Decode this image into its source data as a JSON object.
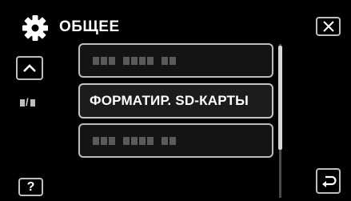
{
  "header": {
    "title": "ОБЩЕЕ",
    "settings_icon": "gear-icon"
  },
  "controls": {
    "close_icon": "close-icon",
    "up_icon": "chevron-up-icon",
    "help_label": "?",
    "back_icon": "return-icon"
  },
  "menu": {
    "items": [
      {
        "label": "",
        "disabled": true
      },
      {
        "label": "ФОРМАТИР. SD-КАРТЫ",
        "disabled": false
      },
      {
        "label": "",
        "disabled": true
      }
    ]
  },
  "page_indicator": {
    "separator": "/"
  },
  "colors": {
    "background": "#000000",
    "text": "#ffffff",
    "border": "#c4c4c4"
  }
}
